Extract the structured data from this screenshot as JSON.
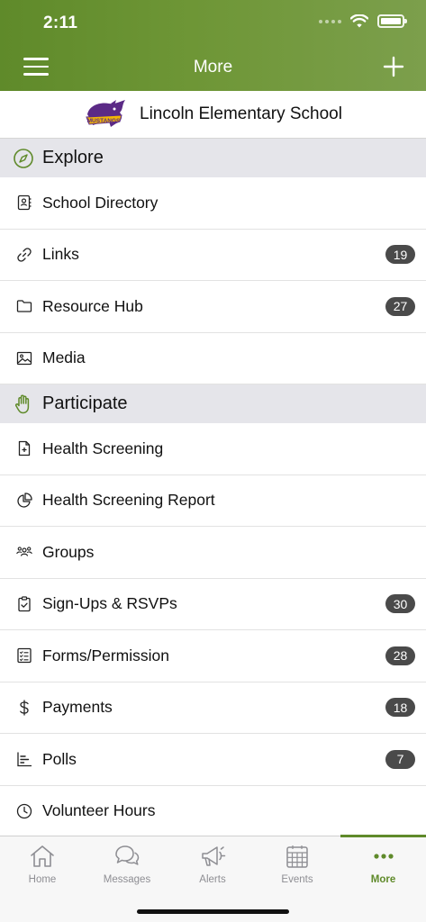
{
  "status_bar": {
    "time": "2:11"
  },
  "nav": {
    "title": "More"
  },
  "school": {
    "name": "Lincoln Elementary School",
    "logo_text": "MUSTANGS"
  },
  "sections": [
    {
      "title": "Explore",
      "icon": "compass-icon",
      "items": [
        {
          "label": "School Directory",
          "icon": "contact-book-icon",
          "badge": ""
        },
        {
          "label": "Links",
          "icon": "link-icon",
          "badge": "19"
        },
        {
          "label": "Resource Hub",
          "icon": "folder-icon",
          "badge": "27"
        },
        {
          "label": "Media",
          "icon": "image-icon",
          "badge": ""
        }
      ]
    },
    {
      "title": "Participate",
      "icon": "raised-hand-icon",
      "items": [
        {
          "label": "Health Screening",
          "icon": "medical-file-icon",
          "badge": ""
        },
        {
          "label": "Health Screening Report",
          "icon": "pie-chart-icon",
          "badge": ""
        },
        {
          "label": "Groups",
          "icon": "group-icon",
          "badge": ""
        },
        {
          "label": "Sign-Ups & RSVPs",
          "icon": "clipboard-check-icon",
          "badge": "30"
        },
        {
          "label": "Forms/Permission",
          "icon": "checklist-icon",
          "badge": "28"
        },
        {
          "label": "Payments",
          "icon": "dollar-icon",
          "badge": "18"
        },
        {
          "label": "Polls",
          "icon": "bar-chart-icon",
          "badge": "7"
        },
        {
          "label": "Volunteer Hours",
          "icon": "clock-icon",
          "badge": ""
        }
      ]
    }
  ],
  "tabs": [
    {
      "label": "Home",
      "icon": "home-icon",
      "active": false
    },
    {
      "label": "Messages",
      "icon": "chat-bubbles-icon",
      "active": false
    },
    {
      "label": "Alerts",
      "icon": "megaphone-icon",
      "active": false
    },
    {
      "label": "Events",
      "icon": "calendar-icon",
      "active": false
    },
    {
      "label": "More",
      "icon": "ellipsis-icon",
      "active": true
    }
  ],
  "colors": {
    "brand_green": "#5f8a2a",
    "badge": "#4a4a4a",
    "section_bg": "#e5e5ea",
    "logo_purple": "#5b2a86",
    "logo_gold": "#f2b705"
  }
}
